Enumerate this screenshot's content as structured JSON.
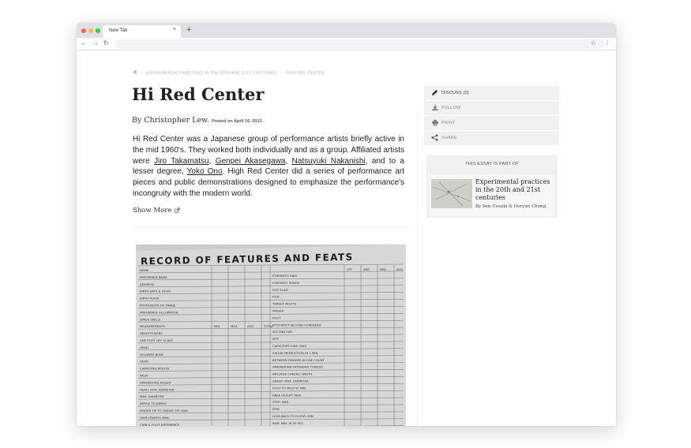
{
  "browser": {
    "tab_title": "New Tab",
    "tab_close": "×",
    "new_tab": "+",
    "back": "←",
    "forward": "→",
    "reload": "↻",
    "bookmark": "☆",
    "menu": "⋮"
  },
  "breadcrumb": {
    "home_icon": "home-icon",
    "separator": "›",
    "items": [
      "EXPERIMENTAL PRACTICES IN THE 20TH AND 21ST CENTURIES",
      "HIGH RED CENTER"
    ]
  },
  "article": {
    "title": "Hi Red Center",
    "author": "By Christopher Lew.",
    "posted": "Posted on April 10, 2013.",
    "body": {
      "p1": "Hi Red Center was a Japanese group of performance artists briefly active in the mid 1960's. They worked both individually and as a group. Affiliated artists were ",
      "link1": "Jiro Takamatsu",
      "sep1": ", ",
      "link2": "Genpei Akasegawa",
      "sep2": ", ",
      "link3": "Natsuyuki Nakanishi",
      "p2": ", and to a lesser degree, ",
      "link4": "Yoko Ono",
      "p3": ". High Red Center did a series of performance art pieces and public demonstrations designed to emphasize the performance's incongruity with the modern world."
    },
    "show_more": "Show More",
    "show_more_icon": "external-link-icon"
  },
  "sidebar": {
    "items": [
      {
        "label": "DISCUSS (0)",
        "icon": "pencil-icon"
      },
      {
        "label": "FOLLOW",
        "icon": "download-icon"
      },
      {
        "label": "PRINT",
        "icon": "printer-icon"
      },
      {
        "label": "SHARE",
        "icon": "share-icon"
      }
    ],
    "part_of": {
      "heading": "THIS ESSAY IS PART OF",
      "title": "Experimental practices in the 20th and 21st centuries",
      "authors": "By Sen Uesaki & Doryun Chong"
    }
  },
  "figure": {
    "heading": "RECORD OF FEATURES AND FEATS",
    "left_rows": [
      "NAME",
      "PREFERRED NAME",
      "ADDRESS",
      "BIRTH DATE & HOUR",
      "BIRTH PLACE",
      "PROFESSION OR TRADE",
      "PREFERRED OCCUPATION",
      "SPACE SKILLS",
      "MEASUREMENTS:",
      "HEIGHTS   BODY",
      "ONE FOOT OFF SCALE",
      "HEAD",
      "VOLUMES   BODY",
      "HEAD",
      "CAPACITIES   MOUTH",
      "PALM",
      "DIMENSIONS   HEIGHT",
      "HEAD: HOR. DIAMETER",
      "MAX. DIAMETER",
      "NIPPLE TO NIPPLE",
      "FINGER TIP TO FINGER TIP: MAX.",
      "HAIR LENGTH: MAX.",
      "CHIN & FOOT DIFFERENCE"
    ],
    "right_rows": [
      "STRENGTH   HAIR",
      "FURTHEST PUNCH",
      "FIST SLAM",
      "KICK",
      "TARGET   MOUTH",
      "FINGER",
      "FOOT",
      "EFFICIENCY   SECOND FOREHEAD",
      "SECOND EAR",
      "SPIT",
      "CAPACITIES   SIDE: MAX.",
      "SALIVA PRODUCTION IN 1 MIN.",
      "BETWEEN FINGERS IN ONE COUNT",
      "DIMENSIONS   EXTENDED TONGUE",
      "INFLATED CHEEKS: WIDTH",
      "GRASP: MAX. DIAMETER",
      "FOOT TO MOUTH: MIN.",
      "KNEE HEIGHT: MAX.",
      "STEP: MAX.",
      "SPIN",
      "LEAN BACK TO FLOOR: MIN.",
      "SKIP: MIN. IN 30 SEC."
    ],
    "left_cols": [
      "MIN.",
      "MAX.",
      "AVG.",
      "TOTAL"
    ],
    "right_cols": [
      "1ST",
      "2ND",
      "3RD",
      "AVG."
    ]
  },
  "colors": {
    "tab_strip": "#dee1e6",
    "close_light": "#ff5f57",
    "minimize_light": "#febc2e",
    "maximize_light": "#28c840",
    "paper": "#d6d9d8",
    "ink": "#1a1c1e"
  }
}
